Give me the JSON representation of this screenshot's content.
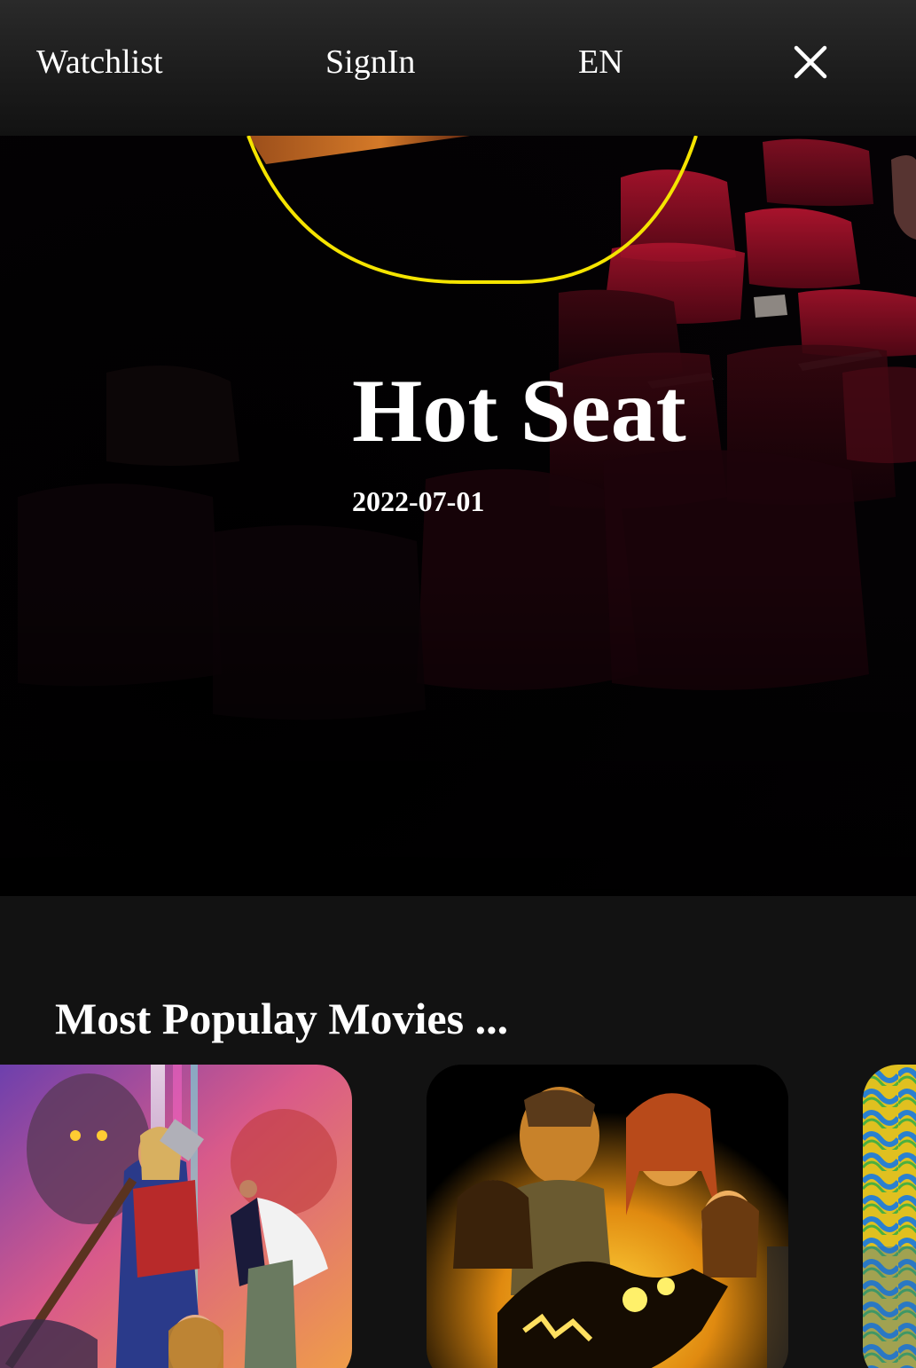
{
  "nav": {
    "watchlist_label": "Watchlist",
    "signin_label": "SignIn",
    "language_label": "EN",
    "close_icon": "close-icon"
  },
  "hero": {
    "title": "Hot Seat",
    "release_date": "2022-07-01",
    "accent_color": "#f5e400"
  },
  "popular": {
    "heading": "Most Populay Movies ..."
  },
  "colors": {
    "page_background": "#121212",
    "nav_background": "#2a2a2a",
    "text": "#ffffff",
    "seat_red": "#8a0f24"
  }
}
